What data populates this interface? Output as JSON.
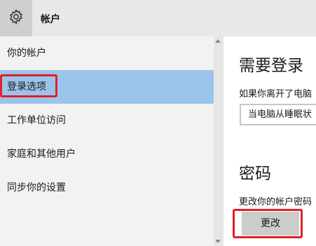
{
  "header": {
    "title": "帐户",
    "icon": "gear-icon"
  },
  "sidebar": {
    "items": [
      {
        "label": "你的帐户"
      },
      {
        "label": "登录选项"
      },
      {
        "label": "工作单位访问"
      },
      {
        "label": "家庭和其他用户"
      },
      {
        "label": "同步你的设置"
      }
    ],
    "selected_index": 1
  },
  "main": {
    "signin_heading": "需要登录",
    "signin_desc": "如果你离开了电脑",
    "signin_dropdown_value": "当电脑从睡眠状",
    "password_heading": "密码",
    "password_desc": "更改你的帐户密码",
    "change_button": "更改"
  },
  "colors": {
    "header_bg": "#e8e8e8",
    "sidebar_bg": "#f2f2f2",
    "selected_bg": "#9bc4ea",
    "highlight_border": "#e0202a",
    "button_bg": "#cccccc"
  }
}
